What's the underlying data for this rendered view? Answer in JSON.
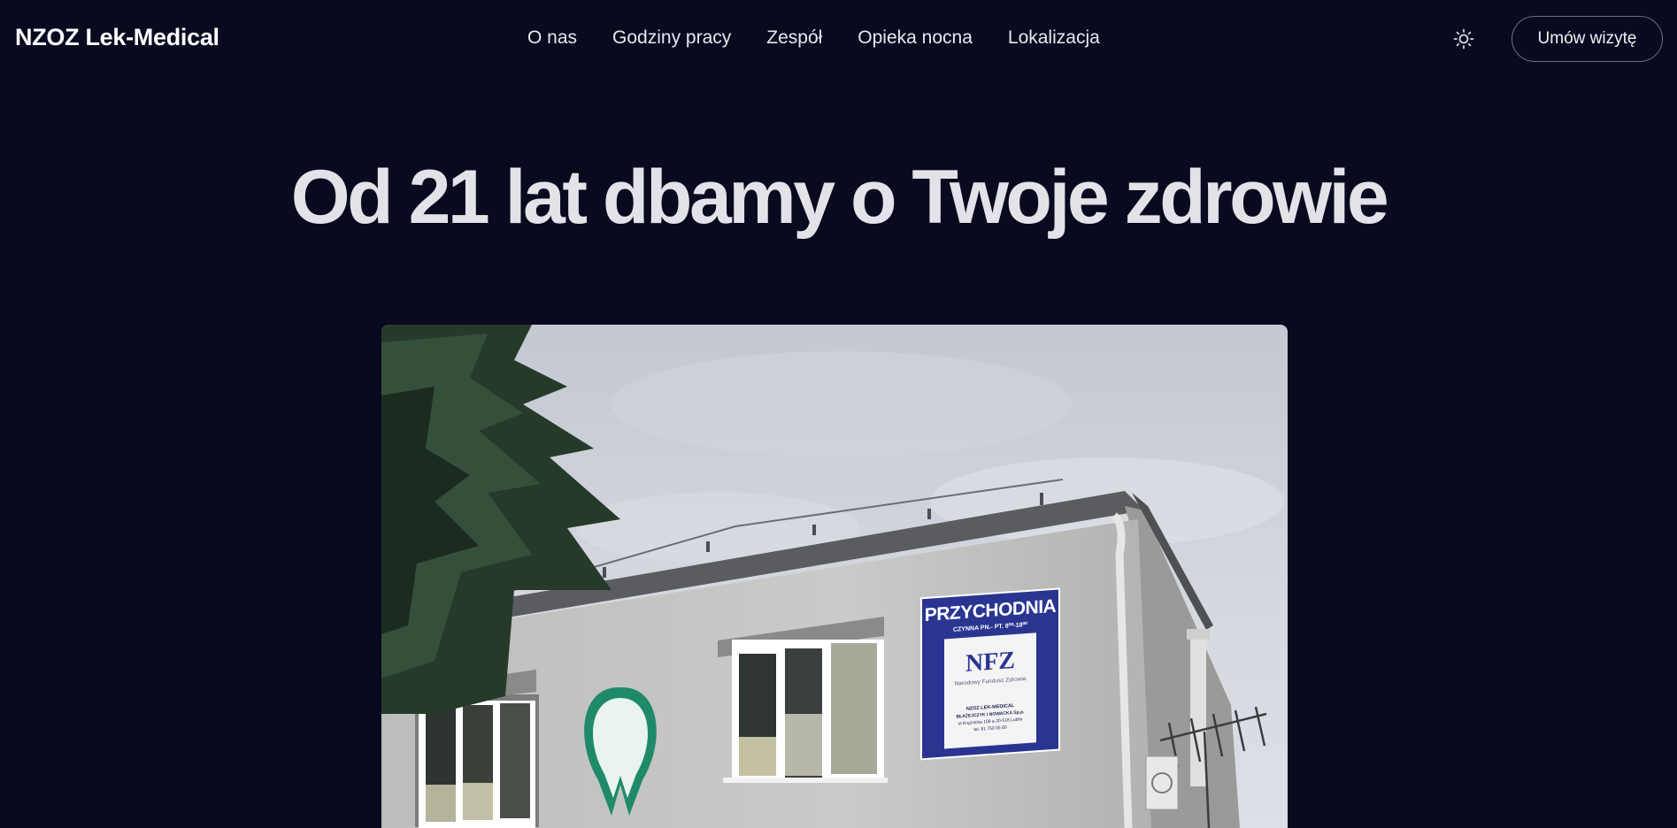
{
  "header": {
    "brand": "NZOZ Lek-Medical",
    "nav": [
      "O nas",
      "Godziny pracy",
      "Zespół",
      "Opieka nocna",
      "Lokalizacja"
    ],
    "theme_toggle_icon": "sun-icon",
    "cta_label": "Umów wizytę"
  },
  "hero": {
    "title": "Od 21 lat dbamy o Twoje zdrowie",
    "photo": {
      "sign_title": "PRZYCHODNIA",
      "sign_hours": "CZYNNA PN.- PT. 8⁰⁰-18⁰⁰",
      "sign_logo": "NFZ",
      "sign_logo_caption": "Narodowy Fundusz Zdrowia",
      "sign_address_lines": [
        "NZOZ LEK-MEDICAL",
        "BŁAŻEJCZYK I NOWACKA Sp.p.",
        "ul.Krężnicka 109 a  20-518 Lublin",
        "tel. 81 750 05 60"
      ]
    }
  },
  "colors": {
    "background": "#090a1f",
    "sign_blue": "#2a3592",
    "wall": "#c9c9c7"
  }
}
